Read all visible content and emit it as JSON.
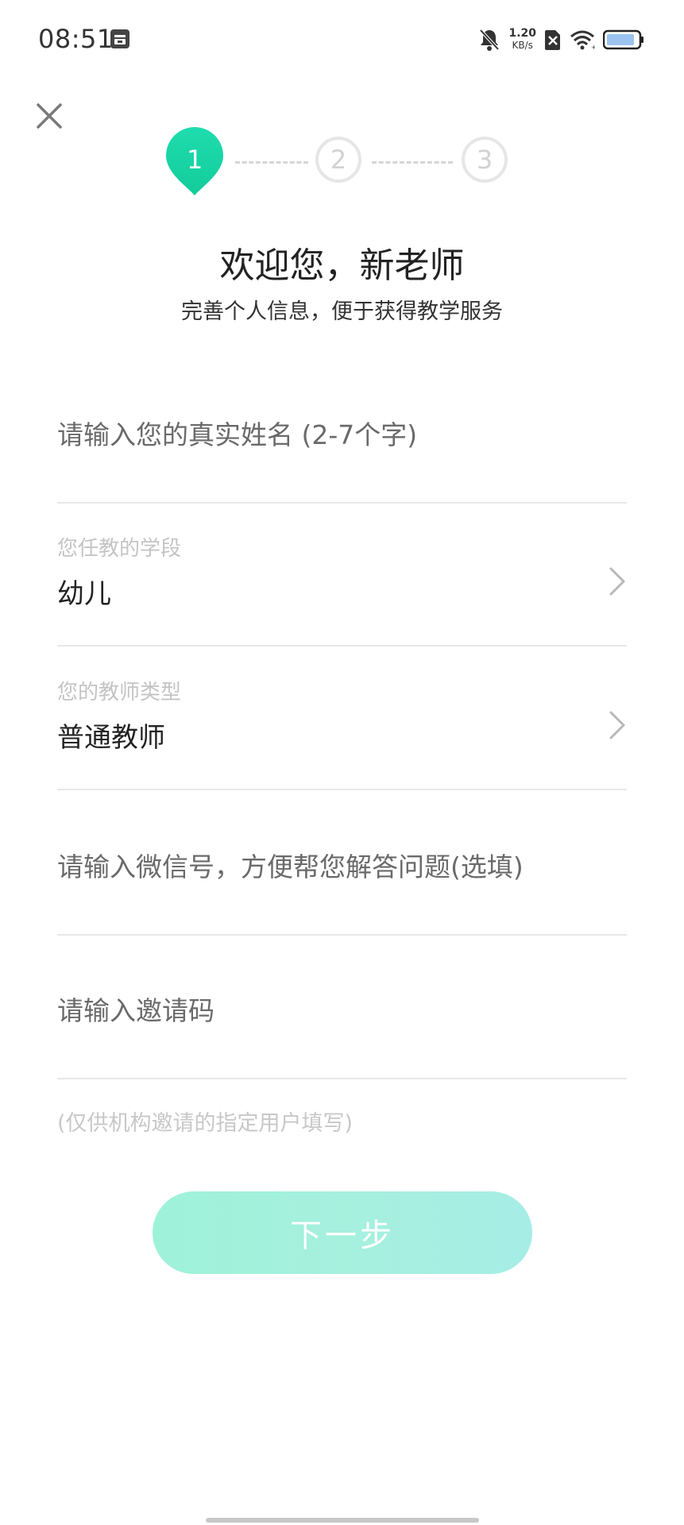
{
  "status_bar": {
    "time": "08:51",
    "net_speed_value": "1.20",
    "net_speed_unit": "KB/s",
    "icons": [
      "sim-card-icon",
      "bell-muted-icon",
      "no-sim-icon",
      "wifi-icon",
      "battery-icon"
    ]
  },
  "stepper": {
    "steps": [
      "1",
      "2",
      "3"
    ],
    "active_step": 1,
    "active_color": "#19d6a4",
    "inactive_color": "#e6e6e6"
  },
  "header": {
    "title": "欢迎您，新老师",
    "subtitle": "完善个人信息，便于获得教学服务"
  },
  "form": {
    "name_placeholder": "请输入您的真实姓名 (2-7个字)",
    "stage": {
      "label": "您任教的学段",
      "value": "幼儿"
    },
    "teacher_type": {
      "label": "您的教师类型",
      "value": "普通教师"
    },
    "wechat_placeholder": "请输入微信号，方便帮您解答问题(选填)",
    "invite_placeholder": "请输入邀请码",
    "invite_hint": "(仅供机构邀请的指定用户填写)"
  },
  "next_button": {
    "label": "下一步"
  },
  "colors": {
    "accent": "#19d6a4",
    "button_gradient_start": "#9ef2d8",
    "button_gradient_end": "#a6ede6"
  }
}
